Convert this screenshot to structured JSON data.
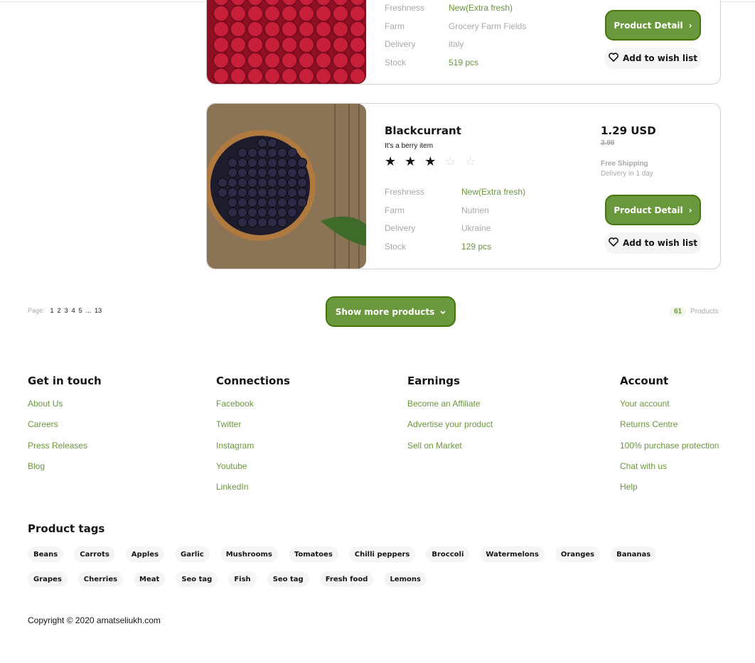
{
  "products": [
    {
      "image": "raspberries",
      "specs": [
        {
          "key": "Freshness",
          "value": "New(Extra fresh)",
          "green": true
        },
        {
          "key": "Farm",
          "value": "Grocery Farm Fields",
          "green": false
        },
        {
          "key": "Delivery",
          "value": "italy",
          "green": false
        },
        {
          "key": "Stock",
          "value": "519 pcs",
          "green": true
        }
      ],
      "detail_label": "Product Detail",
      "wish_label": "Add to wish list"
    },
    {
      "image": "blackcurrant",
      "title": "Blackcurrant",
      "subtitle": "It's a berry item",
      "rating": 3,
      "rating_max": 5,
      "price": "1.29 USD",
      "old_price": "3.99",
      "shipping": "Free Shipping",
      "delivery_time": "Delivery in 1 day",
      "specs": [
        {
          "key": "Freshness",
          "value": "New(Extra fresh)",
          "green": true
        },
        {
          "key": "Farm",
          "value": "Nutrien",
          "green": false
        },
        {
          "key": "Delivery",
          "value": "Ukraine",
          "green": false
        },
        {
          "key": "Stock",
          "value": "129 pcs",
          "green": true
        }
      ],
      "detail_label": "Product Detail",
      "wish_label": "Add to wish list"
    }
  ],
  "pagination": {
    "label": "Page:",
    "pages": [
      "1",
      "2",
      "3",
      "4",
      "5",
      "...",
      "13"
    ]
  },
  "show_more_label": "Show more products",
  "product_count": {
    "value": "61",
    "label": "Products"
  },
  "footer": [
    {
      "title": "Get in touch",
      "links": [
        "About Us",
        "Careers",
        "Press Releases",
        "Blog"
      ]
    },
    {
      "title": "Connections",
      "links": [
        "Facebook",
        "Twitter",
        "Instagram",
        "Youtube",
        "LinkedIn"
      ]
    },
    {
      "title": "Earnings",
      "links": [
        "Become an Affiliate",
        "Advertise your product",
        "Sell on Market"
      ]
    },
    {
      "title": "Account",
      "links": [
        "Your account",
        "Returns Centre",
        "100% purchase protection",
        "Chat with us",
        "Help"
      ]
    }
  ],
  "tags_title": "Product tags",
  "tags": [
    "Beans",
    "Carrots",
    "Apples",
    "Garlic",
    "Mushrooms",
    "Tomatoes",
    "Chilli peppers",
    "Broccoli",
    "Watermelons",
    "Oranges",
    "Bananas",
    "Grapes",
    "Cherries",
    "Meat",
    "Seo tag",
    "Fish",
    "Seo tag",
    "Fresh food",
    "Lemons"
  ],
  "copyright": "Copyright © 2020 amatseliukh.com",
  "colors": {
    "accent": "#6a983c",
    "accent_dark": "#46760a",
    "muted": "#a9a9a9",
    "chip_bg": "#f5f5f5"
  }
}
